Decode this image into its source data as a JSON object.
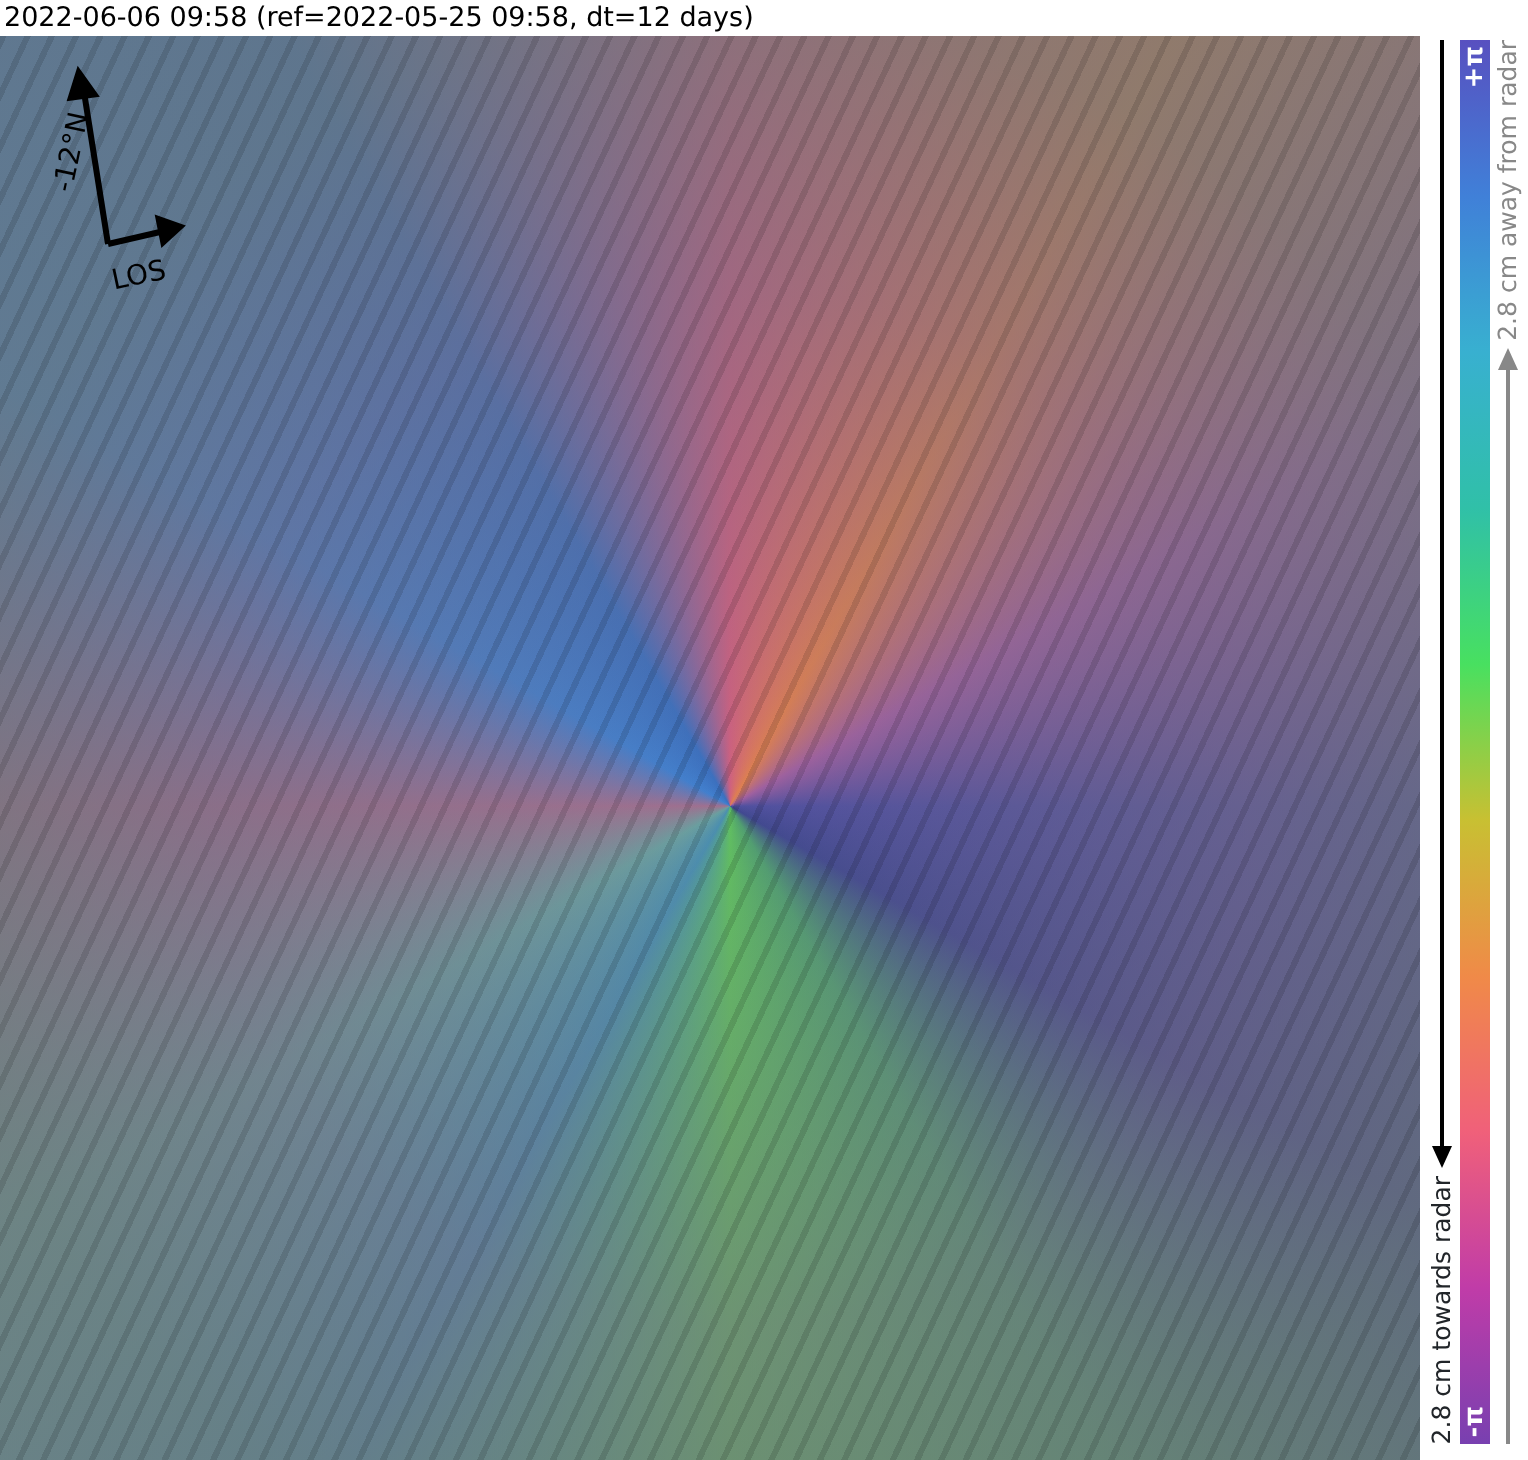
{
  "title": "2022-06-06 09:58 (ref=2022-05-25 09:58, dt=12 days)",
  "map": {
    "north_label": "-12°N",
    "look_label": "LOS"
  },
  "colorbar": {
    "max_label": "+π",
    "min_label": "-π",
    "upper_caption": "2.8 cm away from radar",
    "lower_caption": "2.8 cm towards radar"
  }
}
